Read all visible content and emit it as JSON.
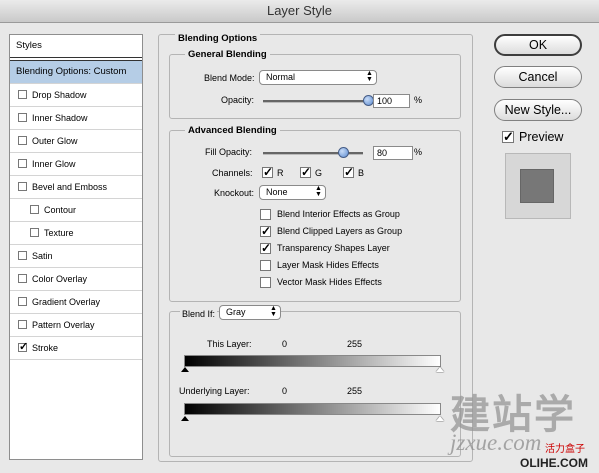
{
  "window": {
    "title": "Layer Style"
  },
  "styles": {
    "header": "Styles",
    "items": [
      {
        "label": "Blending Options: Custom",
        "selected": true
      },
      {
        "label": "Drop Shadow",
        "checked": false
      },
      {
        "label": "Inner Shadow",
        "checked": false
      },
      {
        "label": "Outer Glow",
        "checked": false
      },
      {
        "label": "Inner Glow",
        "checked": false
      },
      {
        "label": "Bevel and Emboss",
        "checked": false
      },
      {
        "label": "Contour",
        "checked": false,
        "indent": true
      },
      {
        "label": "Texture",
        "checked": false,
        "indent": true
      },
      {
        "label": "Satin",
        "checked": false
      },
      {
        "label": "Color Overlay",
        "checked": false
      },
      {
        "label": "Gradient Overlay",
        "checked": false
      },
      {
        "label": "Pattern Overlay",
        "checked": false
      },
      {
        "label": "Stroke",
        "checked": true
      }
    ]
  },
  "blending": {
    "title": "Blending Options",
    "general": {
      "title": "General Blending",
      "blend_mode_label": "Blend Mode:",
      "blend_mode_value": "Normal",
      "opacity_label": "Opacity:",
      "opacity_value": "100",
      "opacity_unit": "%",
      "opacity_fraction": 1.0
    },
    "advanced": {
      "title": "Advanced Blending",
      "fill_opacity_label": "Fill Opacity:",
      "fill_opacity_value": "80",
      "fill_opacity_unit": "%",
      "fill_opacity_fraction": 0.8,
      "channels_label": "Channels:",
      "channels": [
        {
          "label": "R",
          "checked": true
        },
        {
          "label": "G",
          "checked": true
        },
        {
          "label": "B",
          "checked": true
        }
      ],
      "knockout_label": "Knockout:",
      "knockout_value": "None",
      "options": [
        {
          "label": "Blend Interior Effects as Group",
          "checked": false
        },
        {
          "label": "Blend Clipped Layers as Group",
          "checked": true
        },
        {
          "label": "Transparency Shapes Layer",
          "checked": true
        },
        {
          "label": "Layer Mask Hides Effects",
          "checked": false
        },
        {
          "label": "Vector Mask Hides Effects",
          "checked": false
        }
      ]
    },
    "blend_if": {
      "label": "Blend If:",
      "value": "Gray",
      "this_layer_label": "This Layer:",
      "this_layer_low": "0",
      "this_layer_high": "255",
      "underlying_label": "Underlying Layer:",
      "underlying_low": "0",
      "underlying_high": "255"
    }
  },
  "buttons": {
    "ok": "OK",
    "cancel": "Cancel",
    "new_style": "New Style...",
    "preview_label": "Preview",
    "preview_checked": true
  },
  "watermark": {
    "brand_cn": "建站学",
    "site": "jzxue.com",
    "brand_small": "活力盒子",
    "site2": "OLIHE.COM"
  },
  "colors": {
    "selected_row": "#b5cde6",
    "slider_knob": "#5c8bd1",
    "preview_swatch": "#777777"
  }
}
